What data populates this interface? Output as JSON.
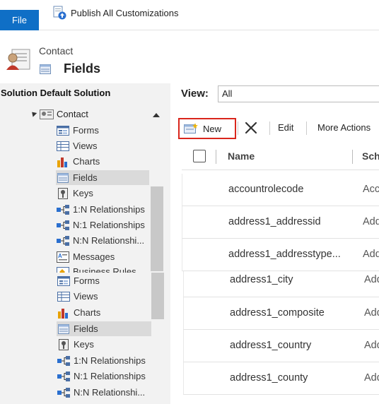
{
  "ribbon": {
    "file_label": "File",
    "publish_label": "Publish All Customizations"
  },
  "header": {
    "entity": "Contact",
    "title": "Fields"
  },
  "left_nav": {
    "solution_title": "Solution Default Solution",
    "entity": "Contact",
    "items_top": [
      {
        "label": "Forms",
        "icon": "forms-icon"
      },
      {
        "label": "Views",
        "icon": "views-icon"
      },
      {
        "label": "Charts",
        "icon": "charts-icon"
      },
      {
        "label": "Fields",
        "icon": "fields-icon",
        "selected": true
      },
      {
        "label": "Keys",
        "icon": "keys-icon"
      },
      {
        "label": "1:N Relationships",
        "icon": "relationship-icon"
      },
      {
        "label": "N:1 Relationships",
        "icon": "relationship-icon"
      },
      {
        "label": "N:N Relationshi...",
        "icon": "relationship-icon"
      },
      {
        "label": "Messages",
        "icon": "messages-icon"
      },
      {
        "label": "Business Rules",
        "icon": "business-rules-icon"
      }
    ],
    "items_bottom": [
      {
        "label": "Forms",
        "icon": "forms-icon"
      },
      {
        "label": "Views",
        "icon": "views-icon"
      },
      {
        "label": "Charts",
        "icon": "charts-icon"
      },
      {
        "label": "Fields",
        "icon": "fields-icon",
        "selected": true
      },
      {
        "label": "Keys",
        "icon": "keys-icon"
      },
      {
        "label": "1:N Relationships",
        "icon": "relationship-icon"
      },
      {
        "label": "N:1 Relationships",
        "icon": "relationship-icon"
      },
      {
        "label": "N:N Relationshi...",
        "icon": "relationship-icon"
      }
    ]
  },
  "view": {
    "label": "View:",
    "value": "All"
  },
  "toolbar": {
    "new_label": "New",
    "edit_label": "Edit",
    "more_label": "More Actions"
  },
  "grid": {
    "columns": [
      "Name",
      "Sch"
    ],
    "rows": [
      {
        "name": "accountrolecode",
        "schema": "Acc"
      },
      {
        "name": "address1_addressid",
        "schema": "Add"
      },
      {
        "name": "address1_addresstype...",
        "schema": "Add"
      },
      {
        "name": "address1_city",
        "schema": "Add"
      },
      {
        "name": "address1_composite",
        "schema": "Add"
      },
      {
        "name": "address1_country",
        "schema": "Add"
      },
      {
        "name": "address1_county",
        "schema": "Add"
      }
    ]
  },
  "colors": {
    "accent": "#0f6fc6",
    "highlight": "#d9261c",
    "nav_bg": "#f2f2f2",
    "nav_selected": "#dadada"
  }
}
